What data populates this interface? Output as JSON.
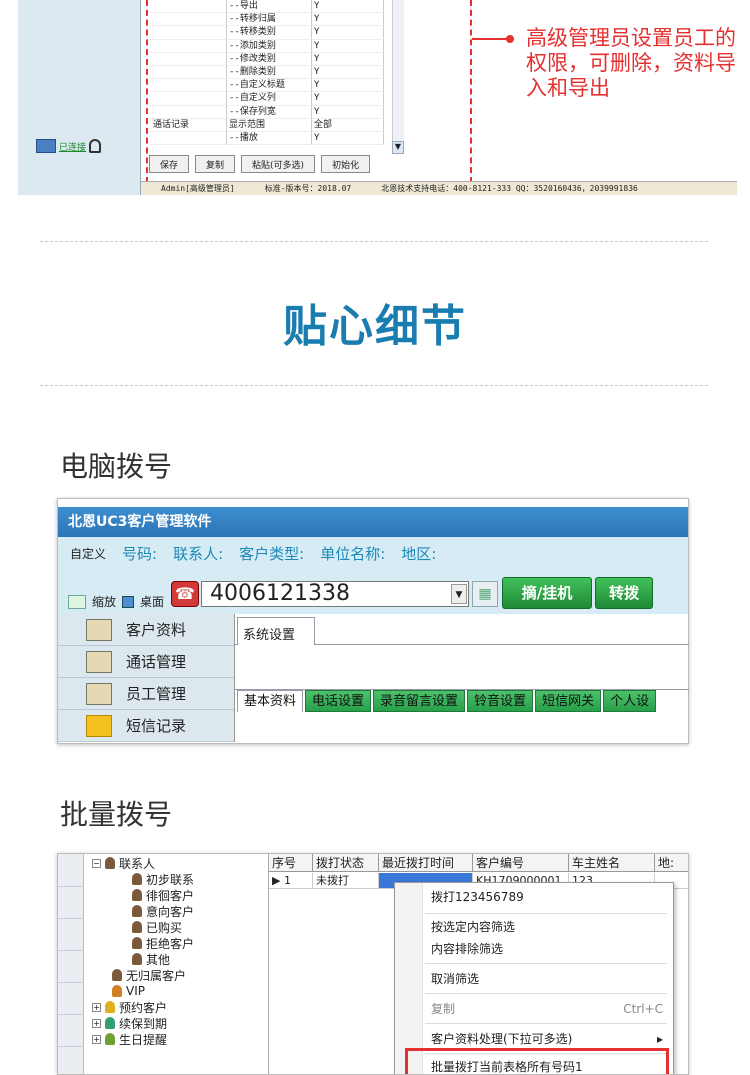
{
  "permissions": {
    "rows": [
      {
        "c1": "",
        "c2": "--导出",
        "c3": "Y"
      },
      {
        "c1": "",
        "c2": "--转移归属",
        "c3": "Y"
      },
      {
        "c1": "",
        "c2": "--转移类别",
        "c3": "Y"
      },
      {
        "c1": "",
        "c2": "--添加类别",
        "c3": "Y"
      },
      {
        "c1": "",
        "c2": "--修改类别",
        "c3": "Y"
      },
      {
        "c1": "",
        "c2": "--删除类别",
        "c3": "Y"
      },
      {
        "c1": "",
        "c2": "--自定义标题",
        "c3": "Y"
      },
      {
        "c1": "",
        "c2": "--自定义列",
        "c3": "Y"
      },
      {
        "c1": "",
        "c2": "--保存列宽",
        "c3": "Y"
      },
      {
        "c1": "通话记录",
        "c2": "显示范围",
        "c3": "全部"
      },
      {
        "c1": "",
        "c2": "--播放",
        "c3": "Y"
      }
    ],
    "buttons": [
      "保存",
      "复制",
      "粘贴(可多选)",
      "初始化"
    ],
    "connection_label": "已连接",
    "status_bar": {
      "user": "Admin[高级管理员]",
      "version": "标准-版本号：2018.07",
      "support": "北恩技术支持电话：400-8121-333   QQ：3520160436，2039991836"
    },
    "callout": "高级管理员设置员工的权限，可删除，资料导入和导出"
  },
  "heading": "贴心细节",
  "section1_title": "电脑拨号",
  "dialer": {
    "app_title": "北恩UC3客户管理软件",
    "custom_label": "自定义",
    "fields": [
      "号码:",
      "联系人:",
      "客户类型:",
      "单位名称:",
      "地区:"
    ],
    "minimize_label": "缩放",
    "desktop_label": "桌面",
    "phone_number": "4006121338",
    "dial_button": "摘/挂机",
    "transfer_button": "转拨",
    "menu": [
      "客户资料",
      "通话管理",
      "员工管理",
      "短信记录"
    ],
    "system_tab": "系统设置",
    "tabs": [
      "基本资料",
      "电话设置",
      "录音留言设置",
      "铃音设置",
      "短信网关",
      "个人设"
    ]
  },
  "section2_title": "批量拨号",
  "batch": {
    "tree": {
      "root": "联系人",
      "children": [
        "初步联系",
        "徘徊客户",
        "意向客户",
        "已购买",
        "拒绝客户",
        "其他"
      ],
      "others": [
        "无归属客户",
        "VIP",
        "预约客户",
        "续保到期",
        "生日提醒"
      ]
    },
    "columns": [
      "序号",
      "拨打状态",
      "最近拨打时间",
      "客户编号",
      "车主姓名",
      "地:"
    ],
    "row": [
      "1",
      "未拨打",
      "",
      "KH1709000001",
      "123",
      ""
    ],
    "context_menu": {
      "dial": "拨打123456789",
      "filter_selected": "按选定内容筛选",
      "filter_exclude": "内容排除筛选",
      "cancel_filter": "取消筛选",
      "copy": "复制",
      "copy_shortcut": "Ctrl+C",
      "customer_process": "客户资料处理(下拉可多选)",
      "submenu_arrow": "▸",
      "batch_dial": "批量拨打当前表格所有号码1"
    }
  }
}
